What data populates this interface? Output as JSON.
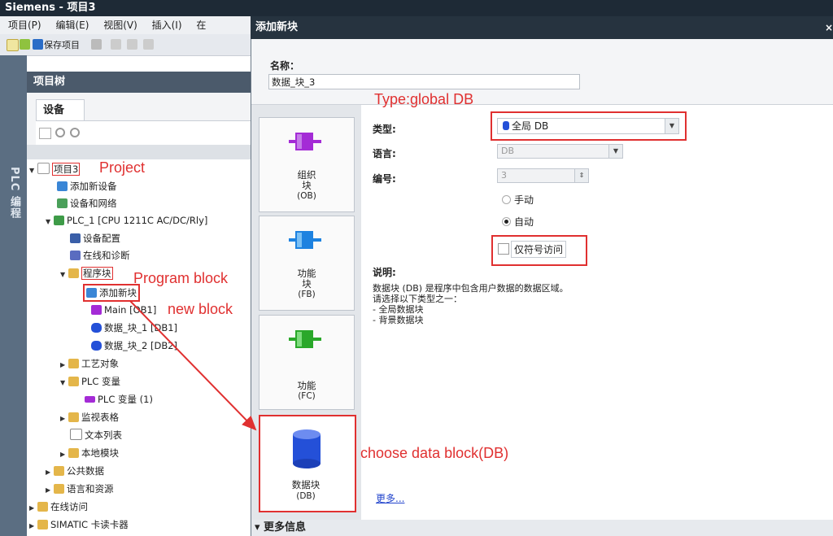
{
  "window": {
    "title": "Siemens  -  项目3"
  },
  "menu": [
    "项目(P)",
    "编辑(E)",
    "视图(V)",
    "插入(I)",
    "在"
  ],
  "toolbar": {
    "save_label": "保存项目"
  },
  "side": {
    "vertical_label": "PLC 编程"
  },
  "tree": {
    "header": "项目树",
    "tab": "设备",
    "items": [
      {
        "label": "项目3",
        "level": 0,
        "icon": "project-icon"
      },
      {
        "label": "添加新设备",
        "level": 1,
        "icon": "add-device-icon"
      },
      {
        "label": "设备和网络",
        "level": 1,
        "icon": "network-icon"
      },
      {
        "label": "PLC_1 [CPU 1211C AC/DC/Rly]",
        "level": 1,
        "icon": "plc-icon"
      },
      {
        "label": "设备配置",
        "level": 2,
        "icon": "device-config-icon"
      },
      {
        "label": "在线和诊断",
        "level": 2,
        "icon": "diagnostics-icon"
      },
      {
        "label": "程序块",
        "level": 2,
        "icon": "folder-icon"
      },
      {
        "label": "添加新块",
        "level": 3,
        "icon": "add-block-icon"
      },
      {
        "label": "Main [OB1]",
        "level": 3,
        "icon": "ob-icon"
      },
      {
        "label": "数据_块_1 [DB1]",
        "level": 3,
        "icon": "db-icon"
      },
      {
        "label": "数据_块_2 [DB2]",
        "level": 3,
        "icon": "db-icon"
      },
      {
        "label": "工艺对象",
        "level": 2,
        "icon": "folder-icon"
      },
      {
        "label": "PLC 变量",
        "level": 2,
        "icon": "folder-icon"
      },
      {
        "label": "PLC 变量 (1)",
        "level": 3,
        "icon": "tag-table-icon"
      },
      {
        "label": "监视表格",
        "level": 2,
        "icon": "folder-icon"
      },
      {
        "label": "文本列表",
        "level": 2,
        "icon": "text-list-icon"
      },
      {
        "label": "本地模块",
        "level": 2,
        "icon": "folder-icon"
      },
      {
        "label": "公共数据",
        "level": 1,
        "icon": "folder-icon"
      },
      {
        "label": "语言和资源",
        "level": 1,
        "icon": "folder-icon"
      },
      {
        "label": "在线访问",
        "level": 0,
        "icon": "folder-icon"
      },
      {
        "label": "SIMATIC 卡读卡器",
        "level": 0,
        "icon": "folder-icon"
      }
    ]
  },
  "dialog": {
    "title": "添加新块",
    "name_label": "名称：",
    "name_value": "数据_块_3",
    "blocks": [
      {
        "label1": "组织",
        "label2": "块",
        "label3": "(OB)",
        "color": "#a42bd6"
      },
      {
        "label1": "功能",
        "label2": "块",
        "label3": "(FB)",
        "color": "#1e82e0"
      },
      {
        "label1": "功能",
        "label2": "",
        "label3": "(FC)",
        "color": "#2aa82a"
      },
      {
        "label1": "数据块",
        "label2": "",
        "label3": "(DB)",
        "color": "#2450d8"
      }
    ],
    "type_label": "类型:",
    "type_value": "全局 DB",
    "language_label": "语言:",
    "language_value": "DB",
    "number_label": "编号:",
    "number_value": "3",
    "radio_manual": "手动",
    "radio_auto": "自动",
    "symbolic_only": "仅符号访问",
    "desc_label": "说明:",
    "desc_lines": [
      "数据块 (DB) 是程序中包含用户数据的数据区域。",
      "请选择以下类型之一：",
      "- 全局数据块",
      "- 背景数据块"
    ],
    "more_link": "更多...",
    "more_info": "▾ 更多信息"
  },
  "annotations": {
    "project": "Project",
    "program_block": "Program block",
    "new_block": "new block",
    "type_note": "Type:global DB",
    "choose_db": "choose data block(DB)"
  },
  "colors": {
    "annotation": "#e03030",
    "dialog_title_bg": "#26333f"
  }
}
